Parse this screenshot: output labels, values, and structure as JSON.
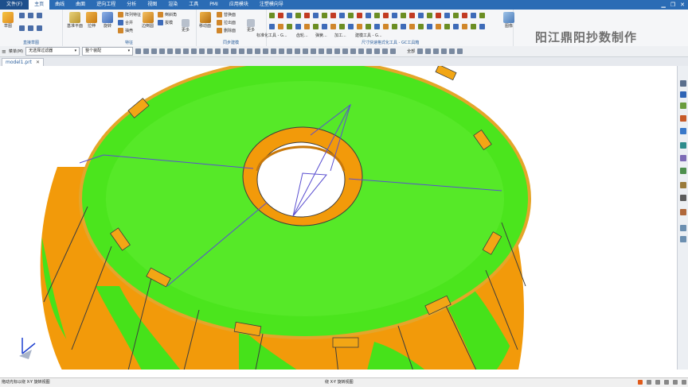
{
  "colors": {
    "menubar": "#2b6cb5",
    "accent": "#1d4f8c",
    "surface_green": "#46e21a",
    "surface_orange": "#f29a0a",
    "edge": "#3d3d3d",
    "construction_line": "#5a4fd0"
  },
  "menu": {
    "file": "文件(F)",
    "tabs": [
      "主页",
      "曲线",
      "曲面",
      "逆向工程",
      "分析",
      "视图",
      "渲染",
      "工具",
      "PMI",
      "应用模块",
      "注塑模向导"
    ],
    "active_tab": 0
  },
  "ribbon": {
    "groups": [
      {
        "label": "直接草图"
      },
      {
        "label": "特征"
      },
      {
        "label": "同步建模"
      },
      {
        "label": "尺寸快速格式化工具 - GC工具箱"
      }
    ],
    "buttons": {
      "sketch": "草图",
      "datum_plane": "基准平面",
      "extrude": "拉伸",
      "revolve": "旋转",
      "pattern_feature": "阵列特征",
      "unite": "合并",
      "shell": "抽壳",
      "edge_blend": "边倒圆",
      "chamfer": "倒斜角",
      "draft": "拔模",
      "more1": "更多",
      "move_face": "移动面",
      "replace_face": "替换面",
      "pull_face": "拉出面",
      "delete_face": "删除面",
      "more2": "更多",
      "image_capture": "图像"
    },
    "sub_rows": {
      "row1": "标准化工具 - G...",
      "row2": "齿轮...",
      "row3": "弹簧...",
      "row4": "加工...",
      "row5": "建模工具 - G..."
    }
  },
  "watermark": "阳江鼎阳抄数制作",
  "toolbar2": {
    "menu_label": "菜单(M)",
    "filter": "无选择过滤器",
    "scope": "整个装配",
    "entire": "全部"
  },
  "document": {
    "tab_label": "model1.prt"
  },
  "status": {
    "left": "拖动光标以绕 X-Y 旋转视图",
    "middle": "绕 X-Y 旋转视图"
  }
}
